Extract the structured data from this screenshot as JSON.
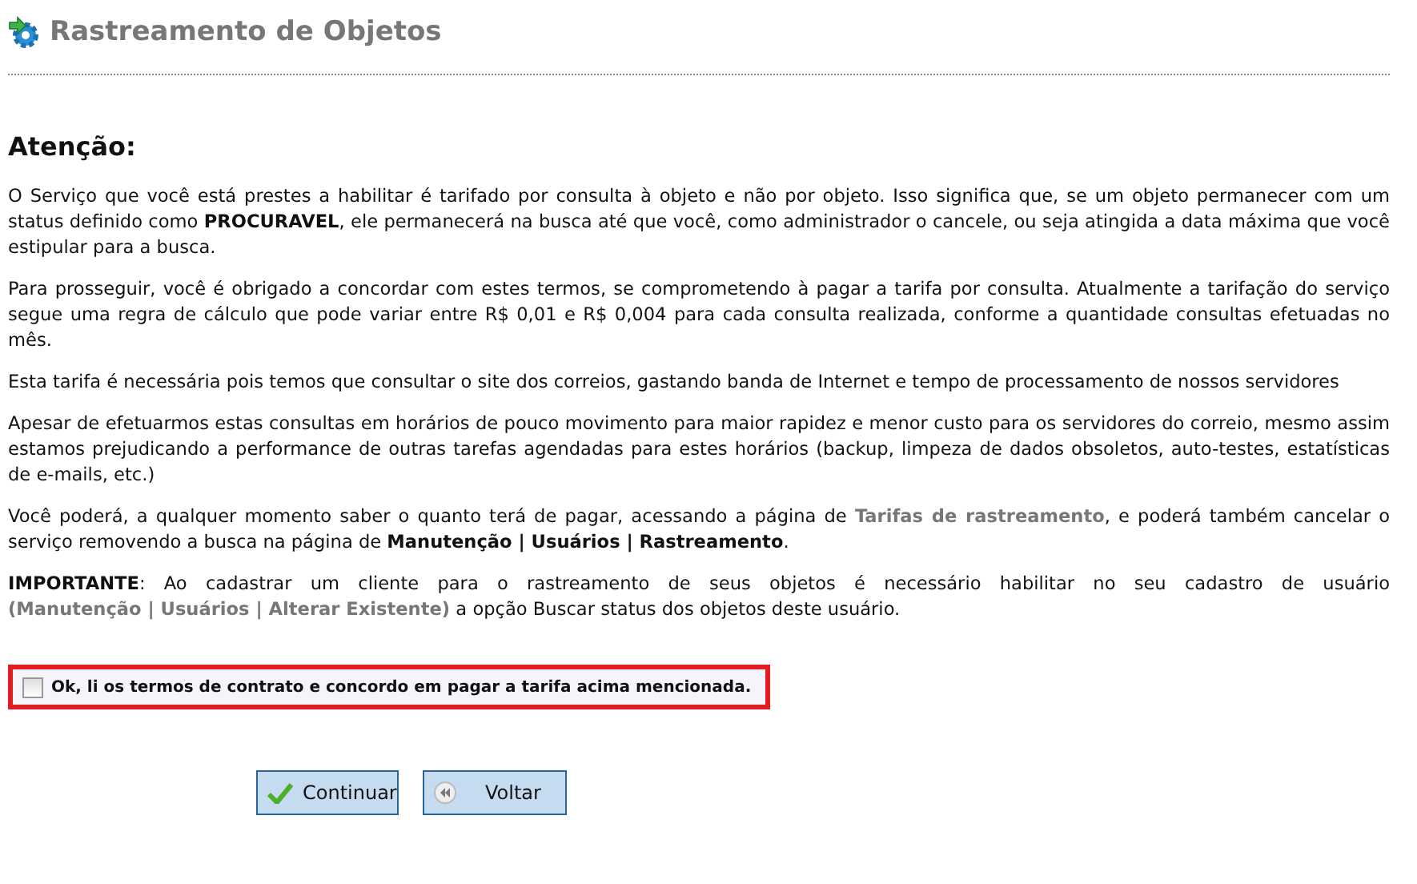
{
  "header": {
    "title": "Rastreamento de Objetos"
  },
  "notice": {
    "heading": "Atenção:",
    "paragraphs": [
      {
        "parts": [
          {
            "kind": "text",
            "text": "O Serviço que você está prestes a habilitar é tarifado por consulta à objeto e não por objeto. Isso significa que, se um objeto permanecer com um status definido como **PROCURAVEL**, ele permanecerá na busca até que você, como administrador o cancele, ou seja atingida a data máxima que você estipular para a busca."
          }
        ]
      },
      {
        "parts": [
          {
            "kind": "text",
            "text": "Para prosseguir, você é obrigado a concordar com estes termos, se comprometendo à pagar a tarifa por consulta. Atualmente a tarifação do serviço segue uma regra de cálculo que pode variar entre R$ 0,01 e R$ 0,004 para cada consulta realizada, conforme a quantidade consultas efetuadas no mês."
          }
        ]
      },
      {
        "parts": [
          {
            "kind": "text",
            "text": "Esta tarifa é necessária pois temos que consultar o site dos correios, gastando banda de Internet e tempo de processamento de nossos servidores"
          }
        ]
      },
      {
        "parts": [
          {
            "kind": "text",
            "text": "Apesar de efetuarmos estas consultas em horários de pouco movimento para maior rapidez e menor custo para os servidores do correio, mesmo assim estamos prejudicando a performance de outras tarefas agendadas para estes horários (backup, limpeza de dados obsoletos, auto-testes, estatísticas de e-mails, etc.)"
          }
        ]
      },
      {
        "parts": [
          {
            "kind": "text",
            "text": "Você poderá, a qualquer momento saber o quanto terá de pagar, acessando a página de "
          },
          {
            "kind": "link",
            "text": "Tarifas de rastreamento"
          },
          {
            "kind": "text",
            "text": ", e poderá também cancelar o serviço removendo a busca na página de **Manutenção | Usuários | Rastreamento**."
          }
        ]
      },
      {
        "parts": [
          {
            "kind": "text",
            "text": "**IMPORTANTE**: Ao cadastrar um cliente para o rastreamento de seus objetos é necessário habilitar no seu cadastro de usuário "
          },
          {
            "kind": "link",
            "text": "(Manutenção | Usuários | Alterar Existente)"
          },
          {
            "kind": "text",
            "text": " a opção Buscar status dos objetos deste usuário."
          }
        ]
      }
    ]
  },
  "agreement": {
    "label": "Ok, li os termos de contrato e concordo em pagar a tarifa acima mencionada.",
    "checked": false
  },
  "buttons": [
    {
      "kind": "continue",
      "label": "Continuar"
    },
    {
      "kind": "back",
      "label": "Voltar"
    }
  ]
}
